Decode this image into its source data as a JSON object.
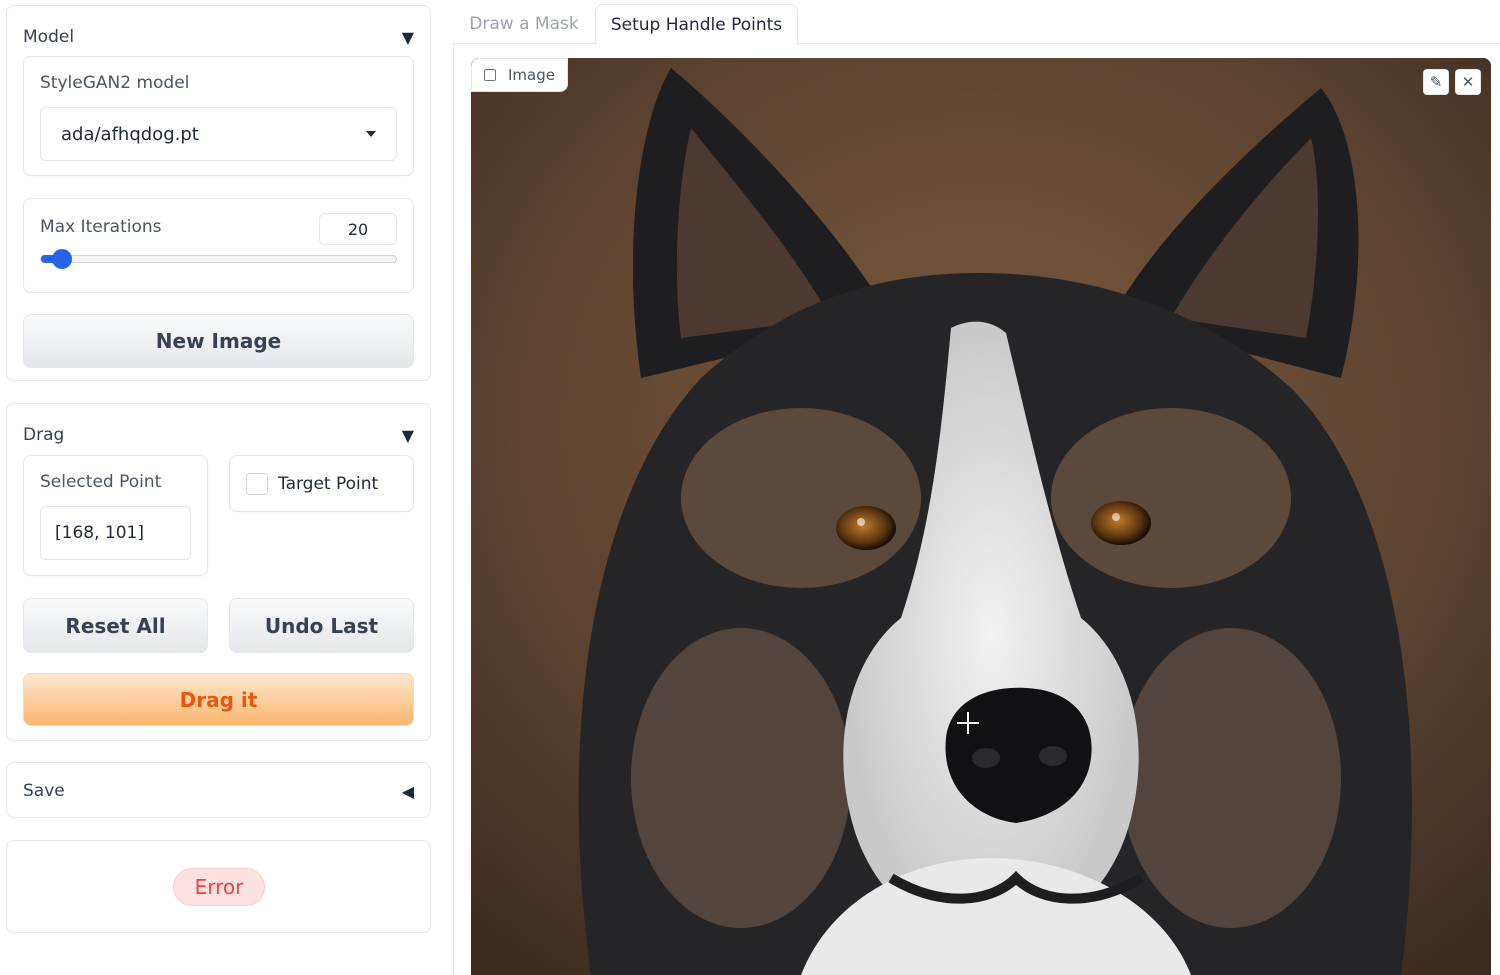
{
  "model_panel": {
    "title": "Model",
    "stylegan_label": "StyleGAN2 model",
    "model_value": "ada/afhqdog.pt",
    "max_iter_label": "Max Iterations",
    "max_iter_value": "20",
    "slider_fraction": 0.06,
    "new_image_label": "New Image"
  },
  "drag_panel": {
    "title": "Drag",
    "selected_point_label": "Selected Point",
    "selected_point_value": "[168, 101]",
    "target_point_label": "Target Point",
    "reset_label": "Reset All",
    "undo_label": "Undo Last",
    "drag_label": "Drag it"
  },
  "save_panel": {
    "title": "Save"
  },
  "status": {
    "error_label": "Error"
  },
  "tabs": [
    {
      "label": "Draw a Mask",
      "active": false
    },
    {
      "label": "Setup Handle Points",
      "active": true
    }
  ],
  "image": {
    "label": "Image"
  },
  "colors": {
    "accent": "#2563eb",
    "primary_text": "#ea580c",
    "error": "#ef4444"
  }
}
